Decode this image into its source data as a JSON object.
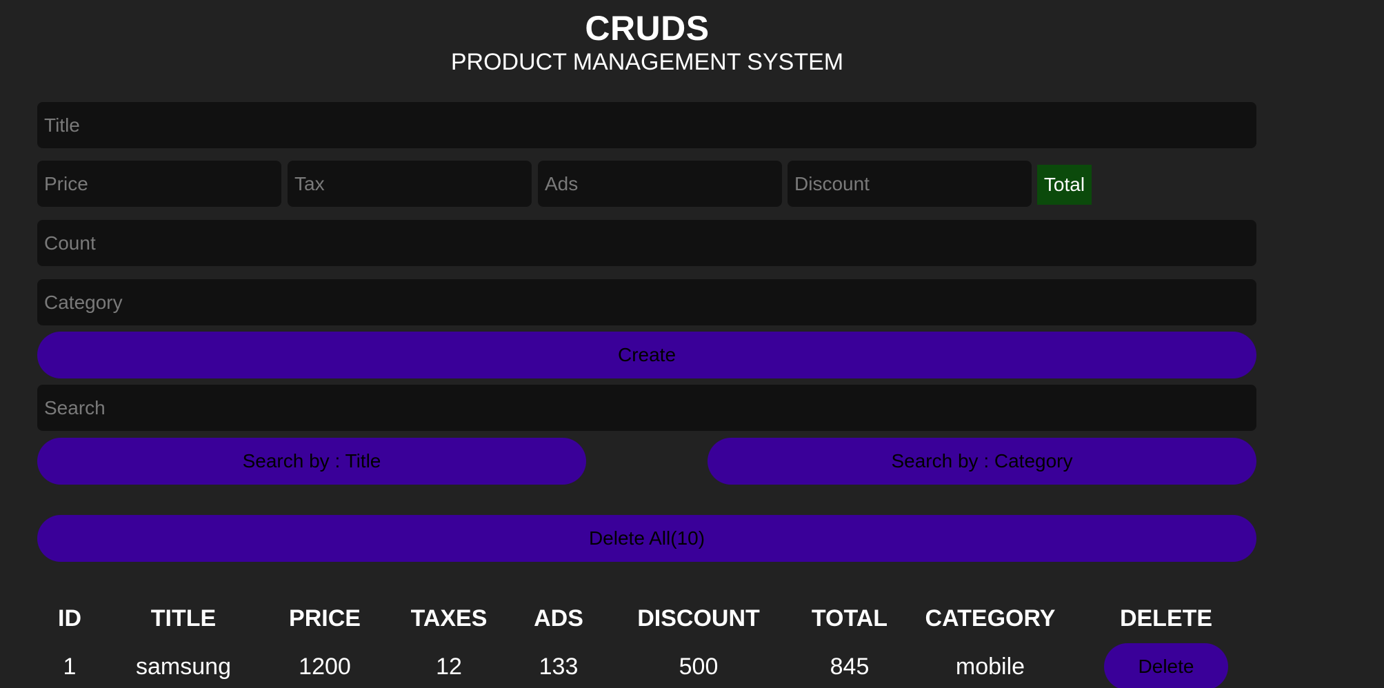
{
  "header": {
    "title": "CRUDS",
    "subtitle": "PRODUCT MANAGEMENT SYSTEM"
  },
  "form": {
    "title_placeholder": "Title",
    "price_placeholder": "Price",
    "tax_placeholder": "Tax",
    "ads_placeholder": "Ads",
    "discount_placeholder": "Discount",
    "total_label": "Total",
    "count_placeholder": "Count",
    "category_placeholder": "Category",
    "create_label": "Create",
    "search_placeholder": "Search",
    "search_title_label": "Search by : Title",
    "search_category_label": "Search by : Category",
    "delete_all_label": "Delete All(10)"
  },
  "table": {
    "headers": [
      "ID",
      "TITLE",
      "PRICE",
      "TAXES",
      "ADS",
      "DISCOUNT",
      "TOTAL",
      "CATEGORY",
      "DELETE"
    ],
    "rows": [
      {
        "id": "1",
        "title": "samsung",
        "price": "1200",
        "taxes": "12",
        "ads": "133",
        "discount": "500",
        "total": "845",
        "category": "mobile",
        "delete_label": "Delete"
      }
    ]
  },
  "colors": {
    "background": "#222222",
    "input_bg": "#111111",
    "accent": "#3a0099",
    "total_bg": "#0b4a0b"
  }
}
